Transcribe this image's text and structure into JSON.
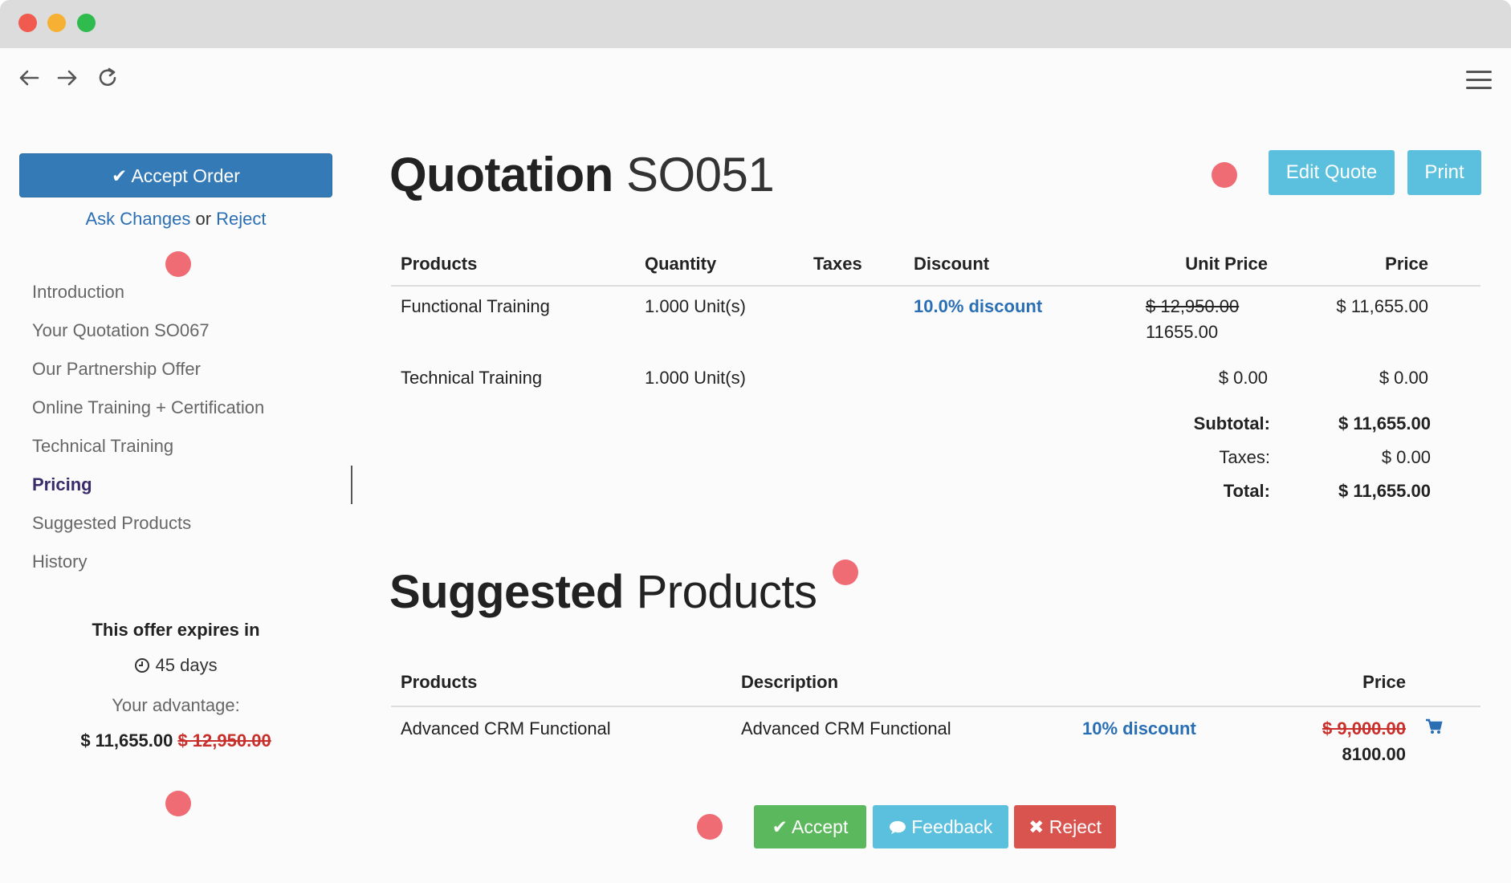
{
  "sidebar": {
    "accept_order_label": "Accept Order",
    "ask_changes_label": "Ask Changes",
    "or_text": "or",
    "reject_label": "Reject",
    "toc": [
      "Introduction",
      "Your Quotation SO067",
      "Our Partnership Offer",
      "Online Training + Certification",
      "Technical Training",
      "Pricing",
      "Suggested Products",
      "History"
    ],
    "active_toc_item": "Pricing",
    "offer_expires_title": "This offer expires in",
    "offer_expires_days": "45 days",
    "advantage_label": "Your advantage:",
    "advantage_amount": "$ 11,655.00",
    "advantage_old_amount": "$ 12,950.00"
  },
  "header": {
    "title_bold": "Quotation",
    "title_light": "SO051",
    "edit_quote_label": "Edit Quote",
    "print_label": "Print"
  },
  "quote_table": {
    "headers": [
      "Products",
      "Quantity",
      "Taxes",
      "Discount",
      "Unit Price",
      "Price"
    ],
    "rows": [
      {
        "product": "Functional Training",
        "quantity": "1.000 Unit(s)",
        "taxes": "",
        "discount": "10.0% discount",
        "unit_price_old": "$ 12,950.00",
        "unit_price": "11655.00",
        "price": "$ 11,655.00"
      },
      {
        "product": "Technical Training",
        "quantity": "1.000 Unit(s)",
        "taxes": "",
        "discount": "",
        "unit_price_old": "",
        "unit_price": "$ 0.00",
        "price": "$ 0.00"
      }
    ]
  },
  "totals": {
    "subtotal_label": "Subtotal:",
    "subtotal": "$ 11,655.00",
    "taxes_label": "Taxes:",
    "taxes": "$ 0.00",
    "total_label": "Total:",
    "total": "$ 11,655.00"
  },
  "suggested": {
    "title_bold": "Suggested",
    "title_light": "Products",
    "headers": [
      "Products",
      "Description",
      "",
      "Price"
    ],
    "rows": [
      {
        "product": "Advanced CRM Functional",
        "description": "Advanced CRM Functional",
        "discount": "10% discount",
        "price_old": "$ 9,000.00",
        "price": "8100.00"
      }
    ]
  },
  "actions": {
    "accept_label": "Accept",
    "feedback_label": "Feedback",
    "reject_label": "Reject"
  },
  "colors": {
    "primary": "#337ab7",
    "info": "#5bc0de",
    "success": "#5cb85c",
    "danger": "#d9534f",
    "marker": "#ef6c75"
  }
}
